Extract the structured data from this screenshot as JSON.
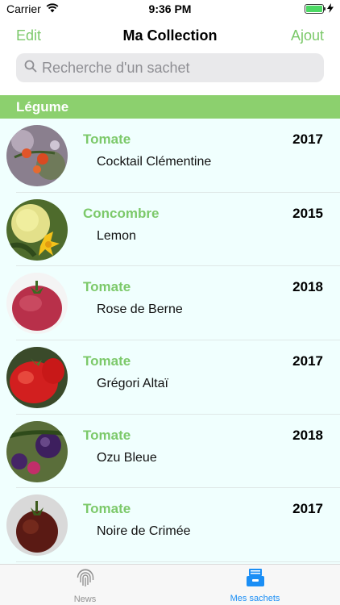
{
  "status_bar": {
    "carrier": "Carrier",
    "time": "9:36 PM"
  },
  "nav": {
    "left": "Edit",
    "title": "Ma Collection",
    "right": "Ajout"
  },
  "search": {
    "placeholder": "Recherche d'un sachet"
  },
  "section": {
    "title": "Légume"
  },
  "items": [
    {
      "name": "Tomate",
      "year": "2017",
      "variety": "Cocktail Clémentine",
      "image": "cocktail-tomato-photo"
    },
    {
      "name": "Concombre",
      "year": "2015",
      "variety": "Lemon",
      "image": "lemon-cucumber-photo"
    },
    {
      "name": "Tomate",
      "year": "2018",
      "variety": "Rose de Berne",
      "image": "pink-tomato-photo"
    },
    {
      "name": "Tomate",
      "year": "2017",
      "variety": "Grégori Altaï",
      "image": "red-tomato-photo"
    },
    {
      "name": "Tomate",
      "year": "2018",
      "variety": "Ozu Bleue",
      "image": "purple-tomato-photo"
    },
    {
      "name": "Tomate",
      "year": "2017",
      "variety": "Noire de Crimée",
      "image": "black-tomato-photo"
    }
  ],
  "tabs": [
    {
      "label": "News",
      "icon": "fingerprint-icon",
      "active": false
    },
    {
      "label": "Mes sachets",
      "icon": "drawer-icon",
      "active": true
    }
  ],
  "colors": {
    "accent": "#7cc96a",
    "section": "#8cd06e",
    "list_bg": "#f0fffe",
    "tab_active": "#1a8ef5"
  }
}
